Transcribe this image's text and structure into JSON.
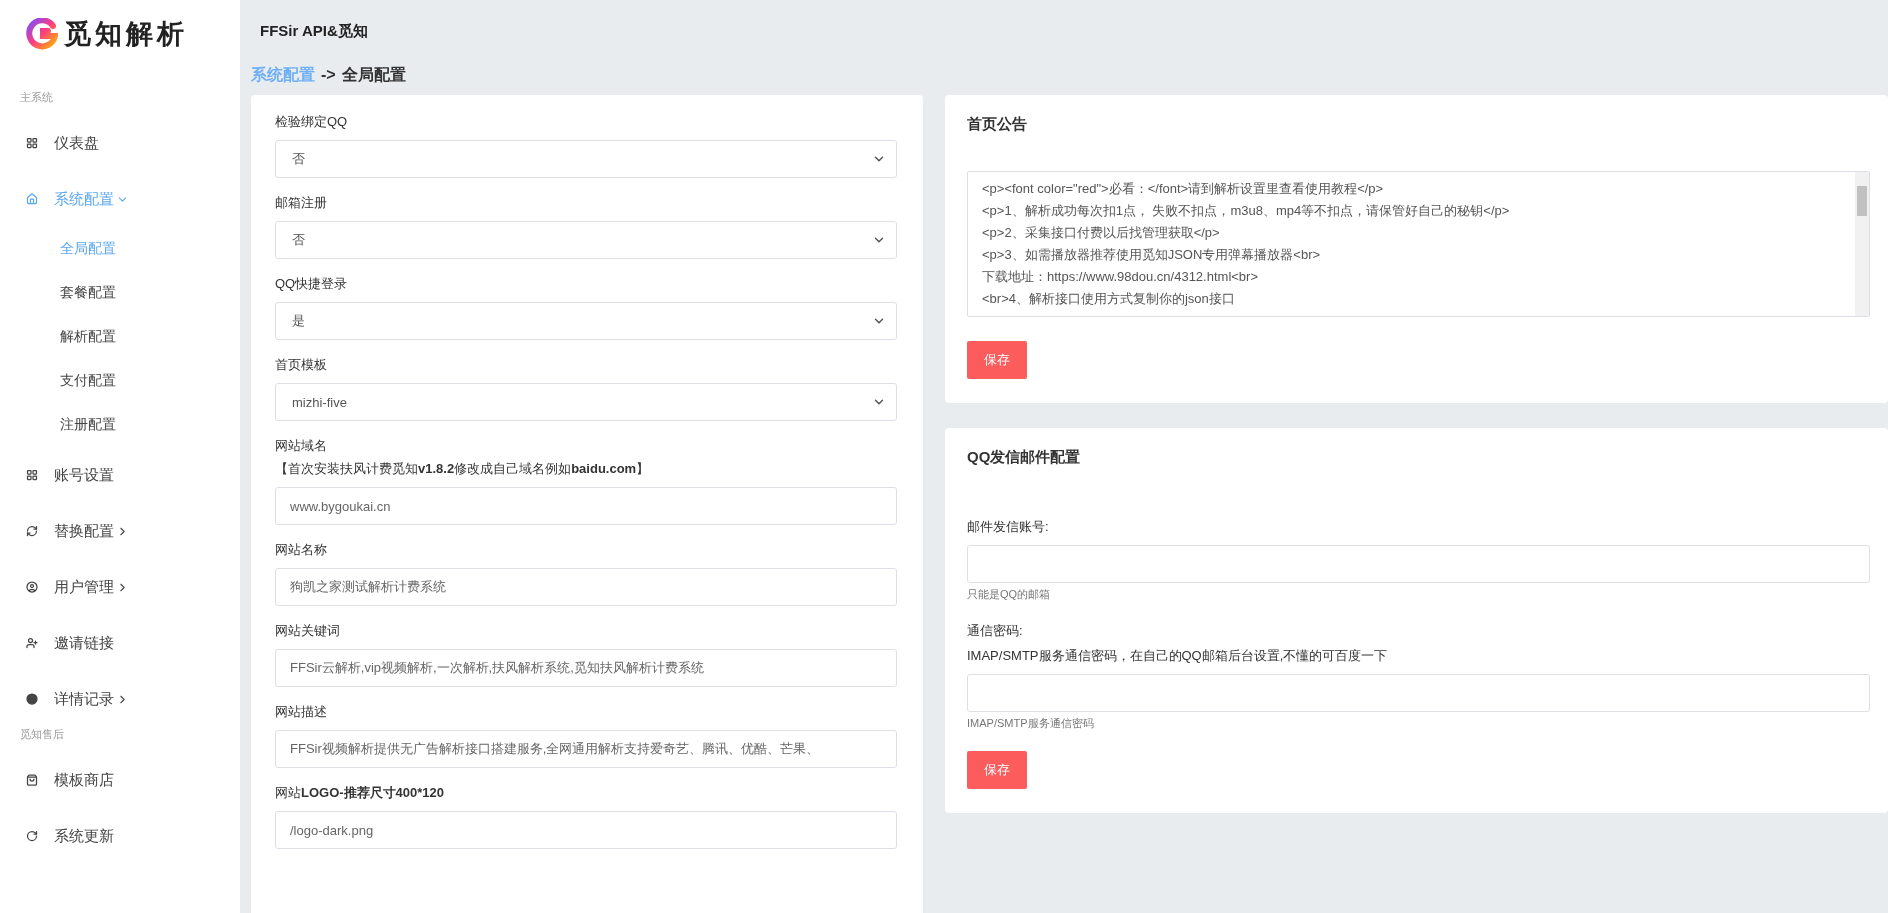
{
  "logo": {
    "text": "觅知解析"
  },
  "header": {
    "title": "FFSir API&觅知"
  },
  "sidebar": {
    "sections": [
      {
        "title": "主系统",
        "items": [
          {
            "label": "仪表盘",
            "selected": false
          },
          {
            "label": "系统配置",
            "selected": true,
            "expanded": true,
            "children": [
              {
                "label": "全局配置",
                "selected": true
              },
              {
                "label": "套餐配置",
                "selected": false
              },
              {
                "label": "解析配置",
                "selected": false
              },
              {
                "label": "支付配置",
                "selected": false
              },
              {
                "label": "注册配置",
                "selected": false
              }
            ]
          },
          {
            "label": "账号设置",
            "selected": false
          },
          {
            "label": "替换配置",
            "selected": false,
            "expanded": false
          },
          {
            "label": "用户管理",
            "selected": false,
            "expanded": false
          },
          {
            "label": "邀请链接",
            "selected": false
          },
          {
            "label": "详情记录",
            "selected": false,
            "expanded": false
          }
        ]
      },
      {
        "title": "觅知售后",
        "items": [
          {
            "label": "模板商店",
            "selected": false
          },
          {
            "label": "系统更新",
            "selected": false
          }
        ]
      }
    ]
  },
  "breadcrumb": {
    "parent": "系统配置",
    "separator": "->",
    "current": "全局配置"
  },
  "global_form": {
    "fields": [
      {
        "kind": "select",
        "label": "检验绑定QQ",
        "value": "否"
      },
      {
        "kind": "select",
        "label": "邮箱注册",
        "value": "否"
      },
      {
        "kind": "select",
        "label": "QQ快捷登录",
        "value": "是"
      },
      {
        "kind": "select",
        "label": "首页模板",
        "value": "mizhi-five"
      },
      {
        "kind": "input",
        "label": "网站域名",
        "note": "【首次安装扶风计费觅知**v1.8.2**修改成自己域名例如**baidu.com**】",
        "value": "www.bygoukai.cn"
      },
      {
        "kind": "input",
        "label": "网站名称",
        "value": "狗凯之家测试解析计费系统"
      },
      {
        "kind": "input",
        "label": "网站关键词",
        "value": "FFSir云解析,vip视频解析,一次解析,扶风解析系统,觅知扶风解析计费系统"
      },
      {
        "kind": "input",
        "label": "网站描述",
        "value": "FFSir视频解析提供无广告解析接口搭建服务,全网通用解析支持爱奇艺、腾讯、优酷、芒果、"
      },
      {
        "kind": "input",
        "label": "网站**LOGO-推荐尺寸400*120**",
        "value": "/logo-dark.png"
      }
    ]
  },
  "announcement": {
    "title": "首页公告",
    "lines": [
      "<p><font color=\"red\">必看：</font>请到解析设置里查看使用教程</p>",
      "<p>1、解析成功每次扣1点， 失败不扣点，m3u8、mp4等不扣点，请保管好自己的秘钥</p>",
      "<p>2、采集接口付费以后找管理获取</p>",
      "<p>3、如需播放器推荐使用觅知JSON专用弹幕播放器<br>",
      "下载地址：https://www.98dou.cn/4312.html<br>",
      "<br>4、解析接口使用方式复制你的json接口"
    ],
    "button": "保存"
  },
  "mail_config": {
    "title": "QQ发信邮件配置",
    "fields": [
      {
        "label": "邮件发信账号:",
        "help": "只能是QQ的邮箱"
      },
      {
        "label": "通信密码:",
        "note": "IMAP/SMTP服务通信密码，在自己的QQ邮箱后台设置,不懂的可百度一下",
        "help": "IMAP/SMTP服务通信密码"
      }
    ],
    "button": "保存"
  }
}
